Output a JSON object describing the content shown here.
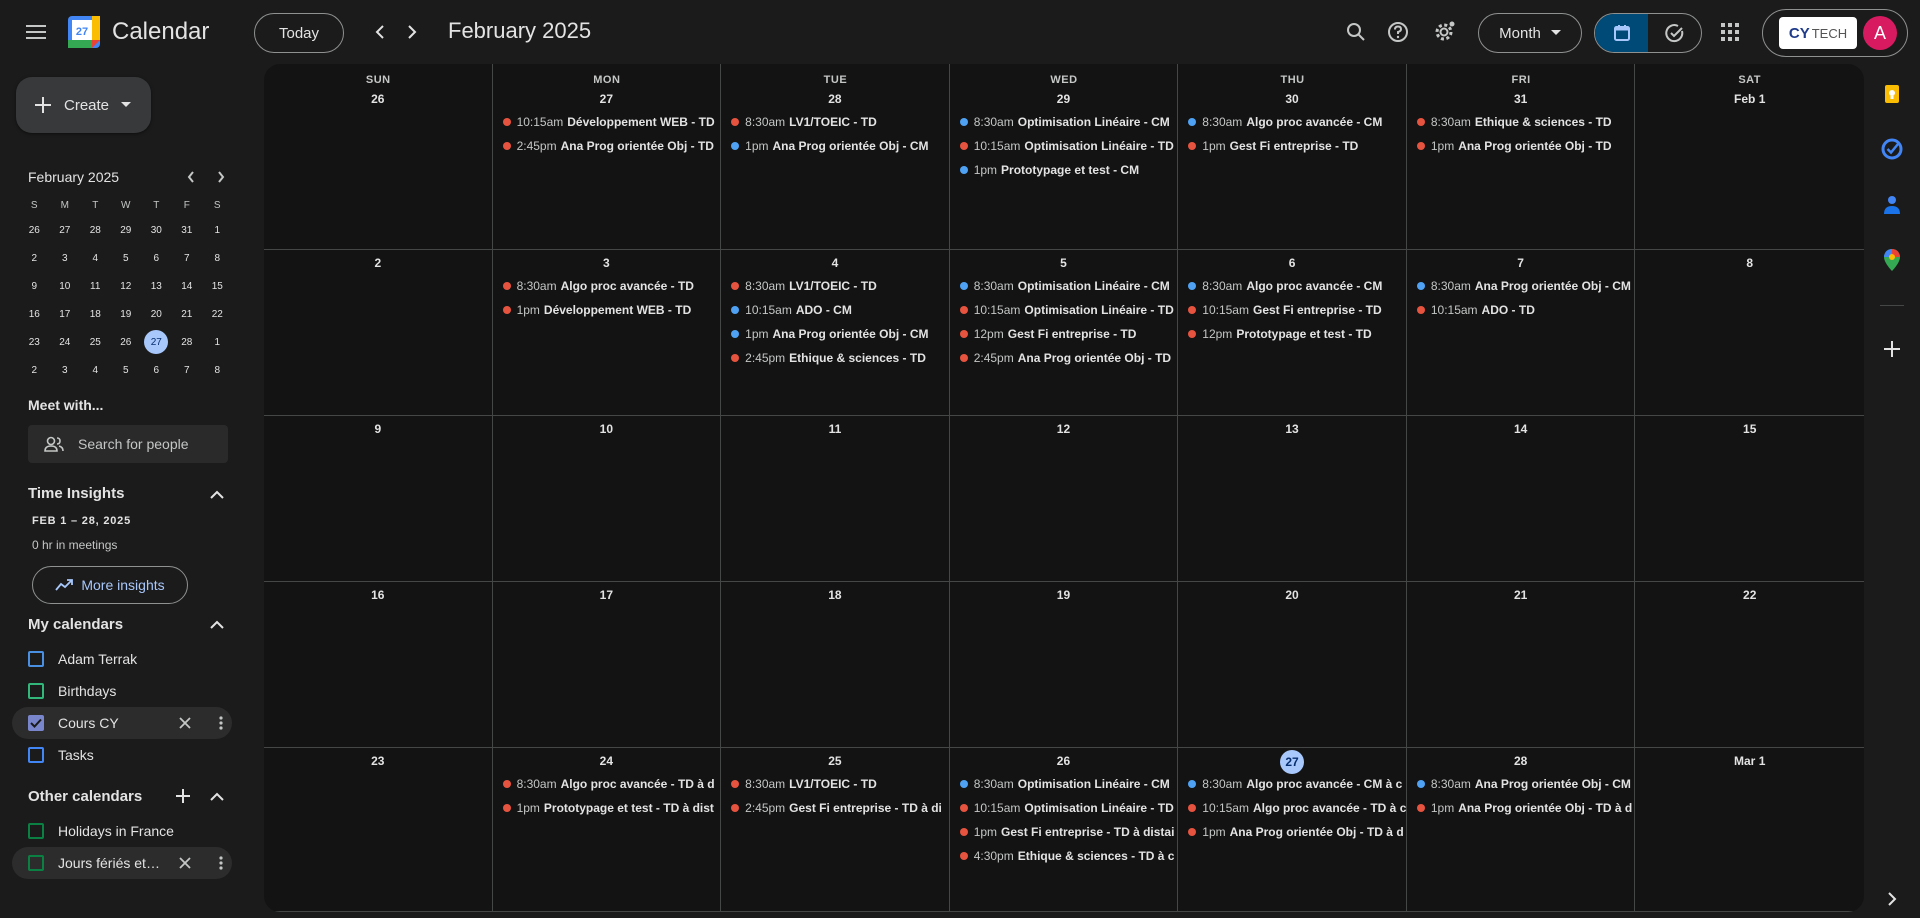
{
  "app": {
    "title": "Calendar",
    "logo_day": "27"
  },
  "toolbar": {
    "today_label": "Today",
    "current_period": "February 2025",
    "view_label": "Month",
    "org_logo_text_1": "CY",
    "org_logo_text_2": "TECH",
    "avatar_initial": "A"
  },
  "sidebar": {
    "create_label": "Create",
    "mini_calendar": {
      "title": "February 2025",
      "dow": [
        "S",
        "M",
        "T",
        "W",
        "T",
        "F",
        "S"
      ],
      "weeks": [
        [
          "26",
          "27",
          "28",
          "29",
          "30",
          "31",
          "1"
        ],
        [
          "2",
          "3",
          "4",
          "5",
          "6",
          "7",
          "8"
        ],
        [
          "9",
          "10",
          "11",
          "12",
          "13",
          "14",
          "15"
        ],
        [
          "16",
          "17",
          "18",
          "19",
          "20",
          "21",
          "22"
        ],
        [
          "23",
          "24",
          "25",
          "26",
          "27",
          "28",
          "1"
        ],
        [
          "2",
          "3",
          "4",
          "5",
          "6",
          "7",
          "8"
        ]
      ],
      "selected": "27"
    },
    "meet_with": {
      "title": "Meet with...",
      "search_placeholder": "Search for people"
    },
    "time_insights": {
      "title": "Time Insights",
      "range": "FEB 1 – 28, 2025",
      "meetings": "0 hr in meetings",
      "more_label": "More insights"
    },
    "my_calendars": {
      "title": "My calendars",
      "items": [
        {
          "label": "Adam Terrak",
          "color": "#4a90e2",
          "checked": false
        },
        {
          "label": "Birthdays",
          "color": "#33b679",
          "checked": false
        },
        {
          "label": "Cours CY",
          "color": "#7986cb",
          "checked": true
        },
        {
          "label": "Tasks",
          "color": "#4285f4",
          "checked": false
        }
      ]
    },
    "other_calendars": {
      "title": "Other calendars",
      "items": [
        {
          "label": "Holidays in France",
          "color": "#0b8043",
          "checked": false
        },
        {
          "label": "Jours fériés et a...",
          "color": "#0b8043",
          "checked": false
        }
      ]
    }
  },
  "month": {
    "days_of_week": [
      "SUN",
      "MON",
      "TUE",
      "WED",
      "THU",
      "FRI",
      "SAT"
    ],
    "colors": {
      "cm": "#4ea1f3",
      "td": "#e6533f"
    },
    "weeks": [
      [
        {
          "label": "26",
          "events": []
        },
        {
          "label": "27",
          "events": [
            {
              "time": "10:15am",
              "title": "Développement WEB - TD",
              "kind": "td"
            },
            {
              "time": "2:45pm",
              "title": "Ana Prog orientée Obj - TD",
              "kind": "td"
            }
          ]
        },
        {
          "label": "28",
          "events": [
            {
              "time": "8:30am",
              "title": "LV1/TOEIC - TD",
              "kind": "td"
            },
            {
              "time": "1pm",
              "title": "Ana Prog orientée Obj - CM",
              "kind": "cm"
            }
          ]
        },
        {
          "label": "29",
          "events": [
            {
              "time": "8:30am",
              "title": "Optimisation Linéaire - CM",
              "kind": "cm"
            },
            {
              "time": "10:15am",
              "title": "Optimisation Linéaire - TD",
              "kind": "td"
            },
            {
              "time": "1pm",
              "title": "Prototypage et test - CM",
              "kind": "cm"
            }
          ]
        },
        {
          "label": "30",
          "events": [
            {
              "time": "8:30am",
              "title": "Algo proc avancée - CM",
              "kind": "cm"
            },
            {
              "time": "1pm",
              "title": "Gest Fi entreprise - TD",
              "kind": "td"
            }
          ]
        },
        {
          "label": "31",
          "events": [
            {
              "time": "8:30am",
              "title": "Ethique & sciences - TD",
              "kind": "td"
            },
            {
              "time": "1pm",
              "title": "Ana Prog orientée Obj - TD",
              "kind": "td"
            }
          ]
        },
        {
          "label": "Feb 1",
          "events": []
        }
      ],
      [
        {
          "label": "2",
          "events": []
        },
        {
          "label": "3",
          "events": [
            {
              "time": "8:30am",
              "title": "Algo proc avancée - TD",
              "kind": "td"
            },
            {
              "time": "1pm",
              "title": "Développement WEB - TD",
              "kind": "td"
            }
          ]
        },
        {
          "label": "4",
          "events": [
            {
              "time": "8:30am",
              "title": "LV1/TOEIC - TD",
              "kind": "td"
            },
            {
              "time": "10:15am",
              "title": "ADO - CM",
              "kind": "cm"
            },
            {
              "time": "1pm",
              "title": "Ana Prog orientée Obj - CM",
              "kind": "cm"
            },
            {
              "time": "2:45pm",
              "title": "Ethique & sciences - TD",
              "kind": "td"
            }
          ]
        },
        {
          "label": "5",
          "events": [
            {
              "time": "8:30am",
              "title": "Optimisation Linéaire - CM",
              "kind": "cm"
            },
            {
              "time": "10:15am",
              "title": "Optimisation Linéaire - TD",
              "kind": "td"
            },
            {
              "time": "12pm",
              "title": "Gest Fi entreprise - TD",
              "kind": "td"
            },
            {
              "time": "2:45pm",
              "title": "Ana Prog orientée Obj - TD",
              "kind": "td"
            }
          ]
        },
        {
          "label": "6",
          "events": [
            {
              "time": "8:30am",
              "title": "Algo proc avancée - CM",
              "kind": "cm"
            },
            {
              "time": "10:15am",
              "title": "Gest Fi entreprise - TD",
              "kind": "td"
            },
            {
              "time": "12pm",
              "title": "Prototypage et test - TD",
              "kind": "td"
            }
          ]
        },
        {
          "label": "7",
          "events": [
            {
              "time": "8:30am",
              "title": "Ana Prog orientée Obj - CM",
              "kind": "cm"
            },
            {
              "time": "10:15am",
              "title": "ADO - TD",
              "kind": "td"
            }
          ]
        },
        {
          "label": "8",
          "events": []
        }
      ],
      [
        {
          "label": "9",
          "events": []
        },
        {
          "label": "10",
          "events": []
        },
        {
          "label": "11",
          "events": []
        },
        {
          "label": "12",
          "events": []
        },
        {
          "label": "13",
          "events": []
        },
        {
          "label": "14",
          "events": []
        },
        {
          "label": "15",
          "events": []
        }
      ],
      [
        {
          "label": "16",
          "events": []
        },
        {
          "label": "17",
          "events": []
        },
        {
          "label": "18",
          "events": []
        },
        {
          "label": "19",
          "events": []
        },
        {
          "label": "20",
          "events": []
        },
        {
          "label": "21",
          "events": []
        },
        {
          "label": "22",
          "events": []
        }
      ],
      [
        {
          "label": "23",
          "events": []
        },
        {
          "label": "24",
          "events": [
            {
              "time": "8:30am",
              "title": "Algo proc avancée - TD à d",
              "kind": "td"
            },
            {
              "time": "1pm",
              "title": "Prototypage et test - TD à dist",
              "kind": "td"
            }
          ]
        },
        {
          "label": "25",
          "events": [
            {
              "time": "8:30am",
              "title": "LV1/TOEIC - TD",
              "kind": "td"
            },
            {
              "time": "2:45pm",
              "title": "Gest Fi entreprise - TD à di",
              "kind": "td"
            }
          ]
        },
        {
          "label": "26",
          "events": [
            {
              "time": "8:30am",
              "title": "Optimisation Linéaire - CM",
              "kind": "cm"
            },
            {
              "time": "10:15am",
              "title": "Optimisation Linéaire - TD",
              "kind": "td"
            },
            {
              "time": "1pm",
              "title": "Gest Fi entreprise - TD à distai",
              "kind": "td"
            },
            {
              "time": "4:30pm",
              "title": "Ethique & sciences - TD à c",
              "kind": "td"
            }
          ]
        },
        {
          "label": "27",
          "today": true,
          "events": [
            {
              "time": "8:30am",
              "title": "Algo proc avancée - CM à c",
              "kind": "cm"
            },
            {
              "time": "10:15am",
              "title": "Algo proc avancée - TD à c",
              "kind": "td"
            },
            {
              "time": "1pm",
              "title": "Ana Prog orientée Obj - TD à d",
              "kind": "td"
            }
          ]
        },
        {
          "label": "28",
          "events": [
            {
              "time": "8:30am",
              "title": "Ana Prog orientée Obj - CM",
              "kind": "cm"
            },
            {
              "time": "1pm",
              "title": "Ana Prog orientée Obj - TD à d",
              "kind": "td"
            }
          ]
        },
        {
          "label": "Mar 1",
          "events": []
        }
      ]
    ]
  },
  "right_rail": {
    "icons": [
      "keep-icon",
      "tasks-icon",
      "contacts-icon",
      "maps-icon",
      "add-icon"
    ]
  }
}
